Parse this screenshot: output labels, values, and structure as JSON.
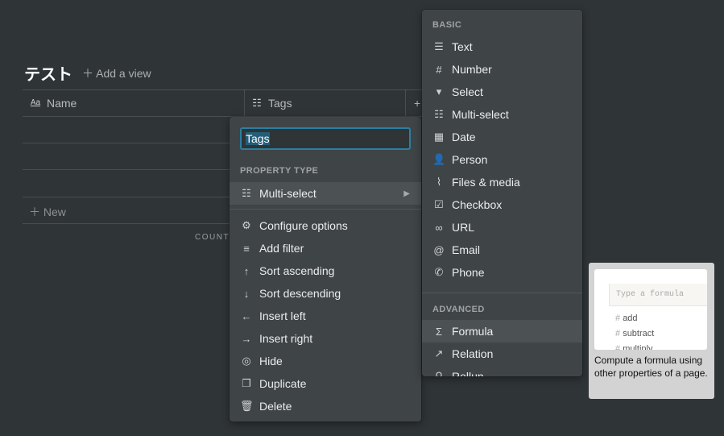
{
  "page": {
    "title": "テスト",
    "add_view": "Add a view"
  },
  "table": {
    "columns": [
      {
        "label": "Name",
        "icon": "text-aa-icon"
      },
      {
        "label": "Tags",
        "icon": "list-icon"
      }
    ],
    "add_column": "+",
    "new_row": "New",
    "count": "COUNT"
  },
  "property_menu": {
    "name_value": "Tags",
    "section_label": "PROPERTY TYPE",
    "type": "Multi-select",
    "actions": [
      {
        "label": "Configure options",
        "icon": "gear-icon",
        "glyph": "⚙"
      },
      {
        "label": "Add filter",
        "icon": "filter-icon",
        "glyph": "≡"
      },
      {
        "label": "Sort ascending",
        "icon": "arrow-up-icon",
        "glyph": "↑"
      },
      {
        "label": "Sort descending",
        "icon": "arrow-down-icon",
        "glyph": "↓"
      },
      {
        "label": "Insert left",
        "icon": "arrow-left-icon",
        "glyph": "←"
      },
      {
        "label": "Insert right",
        "icon": "arrow-right-icon",
        "glyph": "→"
      },
      {
        "label": "Hide",
        "icon": "eye-slash-icon",
        "glyph": "◎"
      },
      {
        "label": "Duplicate",
        "icon": "duplicate-icon",
        "glyph": "❐"
      },
      {
        "label": "Delete",
        "icon": "trash-icon",
        "glyph": "🗑"
      }
    ]
  },
  "type_menu": {
    "basic_label": "BASIC",
    "basic": [
      {
        "label": "Text",
        "icon": "text-icon",
        "glyph": "☰"
      },
      {
        "label": "Number",
        "icon": "hash-icon",
        "glyph": "#"
      },
      {
        "label": "Select",
        "icon": "select-icon",
        "glyph": "▾"
      },
      {
        "label": "Multi-select",
        "icon": "list-icon",
        "glyph": "☷"
      },
      {
        "label": "Date",
        "icon": "calendar-icon",
        "glyph": "▦"
      },
      {
        "label": "Person",
        "icon": "person-icon",
        "glyph": "👤"
      },
      {
        "label": "Files & media",
        "icon": "paperclip-icon",
        "glyph": "⌇"
      },
      {
        "label": "Checkbox",
        "icon": "checkbox-icon",
        "glyph": "☑"
      },
      {
        "label": "URL",
        "icon": "link-icon",
        "glyph": "∞"
      },
      {
        "label": "Email",
        "icon": "at-icon",
        "glyph": "@"
      },
      {
        "label": "Phone",
        "icon": "phone-icon",
        "glyph": "✆"
      }
    ],
    "advanced_label": "ADVANCED",
    "advanced": [
      {
        "label": "Formula",
        "icon": "sigma-icon",
        "glyph": "Σ"
      },
      {
        "label": "Relation",
        "icon": "arrow-up-right-icon",
        "glyph": "↗"
      },
      {
        "label": "Rollup",
        "icon": "search-icon",
        "glyph": "⚲"
      }
    ]
  },
  "tooltip": {
    "placeholder": "Type a formula",
    "functions": [
      "add",
      "subtract",
      "multiply"
    ],
    "description": "Compute a formula using other properties of a page."
  },
  "colors": {
    "background": "#2f3437",
    "menu": "#3f4447",
    "focus": "#2383e2",
    "tooltip": "#d3d3d3"
  }
}
